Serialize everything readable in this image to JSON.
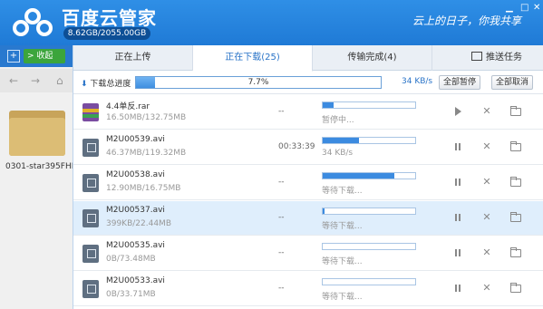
{
  "app": {
    "title": "百度云管家",
    "quota": "8.62GB/2055.00GB",
    "slogan": "云上的日子，你我共享"
  },
  "left_panel": {
    "collapse_label": "收起",
    "folder_name": "0301-star395FHD"
  },
  "tabs": [
    {
      "label": "正在上传",
      "active": false
    },
    {
      "label": "正在下载(25)",
      "active": true
    },
    {
      "label": "传输完成(4)",
      "active": false
    }
  ],
  "task_button": "推送任务",
  "summary": {
    "label": "下载总进度",
    "progress": 0.077,
    "progress_text": "7.7%",
    "speed": "34 KB/s",
    "pause_all": "全部暂停",
    "cancel_all": "全部取消"
  },
  "downloads": [
    {
      "name": "4.4单反.rar",
      "size": "16.50MB/132.75MB",
      "time": "--",
      "progress": 0.12,
      "status": "暂停中...",
      "icon": "archive-icon",
      "action": "play",
      "selected": false
    },
    {
      "name": "M2U00539.avi",
      "size": "46.37MB/119.32MB",
      "time": "00:33:39",
      "progress": 0.39,
      "status": "34 KB/s",
      "icon": "video-icon",
      "action": "pause",
      "selected": false
    },
    {
      "name": "M2U00538.avi",
      "size": "12.90MB/16.75MB",
      "time": "--",
      "progress": 0.77,
      "status": "等待下载...",
      "icon": "video-icon",
      "action": "pause",
      "selected": false
    },
    {
      "name": "M2U00537.avi",
      "size": "399KB/22.44MB",
      "time": "--",
      "progress": 0.02,
      "status": "等待下载...",
      "icon": "video-icon",
      "action": "pause",
      "selected": true
    },
    {
      "name": "M2U00535.avi",
      "size": "0B/73.48MB",
      "time": "--",
      "progress": 0,
      "status": "等待下载...",
      "icon": "video-icon",
      "action": "pause",
      "selected": false
    },
    {
      "name": "M2U00533.avi",
      "size": "0B/33.71MB",
      "time": "--",
      "progress": 0,
      "status": "等待下载...",
      "icon": "video-icon",
      "action": "pause",
      "selected": false
    }
  ]
}
